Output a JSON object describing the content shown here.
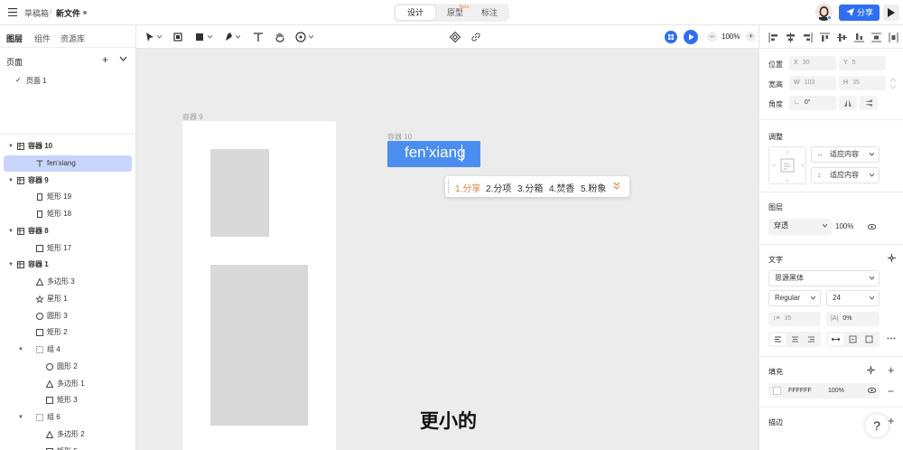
{
  "topbar": {
    "breadcrumb_parent": "草稿箱",
    "breadcrumb_sep": "/",
    "file_name": "新文件",
    "tabs": [
      "设计",
      "原型",
      "标注"
    ],
    "beta": "Beta",
    "share_label": "分享"
  },
  "left_panel": {
    "tabs": [
      "图层",
      "组件",
      "资源库"
    ],
    "pages_title": "页面",
    "pages_add": "+",
    "page_item": "页面 1",
    "page_check": "✓",
    "layers": [
      {
        "name": "容器 10",
        "icon": "frame-icon",
        "bold": true,
        "indent": 0,
        "arrow": true
      },
      {
        "name": "fen'xiang",
        "icon": "text-icon",
        "bold": false,
        "indent": 1,
        "arrow": false,
        "selected": true
      },
      {
        "name": "容器 9",
        "icon": "frame-icon",
        "bold": true,
        "indent": 0,
        "arrow": true
      },
      {
        "name": "矩形 19",
        "icon": "rect-icon",
        "bold": false,
        "indent": 1,
        "arrow": false
      },
      {
        "name": "矩形 18",
        "icon": "rect-icon",
        "bold": false,
        "indent": 1,
        "arrow": false
      },
      {
        "name": "容器 8",
        "icon": "frame-icon",
        "bold": true,
        "indent": 0,
        "arrow": true
      },
      {
        "name": "矩形 17",
        "icon": "square-icon",
        "bold": false,
        "indent": 1,
        "arrow": false
      },
      {
        "name": "容器 1",
        "icon": "frame-icon",
        "bold": true,
        "indent": 0,
        "arrow": true
      },
      {
        "name": "多边形 3",
        "icon": "triangle-icon",
        "bold": false,
        "indent": 1,
        "arrow": false
      },
      {
        "name": "星形 1",
        "icon": "star-icon",
        "bold": false,
        "indent": 1,
        "arrow": false
      },
      {
        "name": "圆形 3",
        "icon": "circle-icon",
        "bold": false,
        "indent": 1,
        "arrow": false
      },
      {
        "name": "矩形 2",
        "icon": "square-icon",
        "bold": false,
        "indent": 1,
        "arrow": false
      },
      {
        "name": "组 4",
        "icon": "group-icon",
        "bold": false,
        "indent": 1,
        "arrow": true
      },
      {
        "name": "圆形 2",
        "icon": "circle-icon",
        "bold": false,
        "indent": 2,
        "arrow": false
      },
      {
        "name": "多边形 1",
        "icon": "triangle-icon",
        "bold": false,
        "indent": 2,
        "arrow": false
      },
      {
        "name": "矩形 3",
        "icon": "square-icon",
        "bold": false,
        "indent": 2,
        "arrow": false
      },
      {
        "name": "组 6",
        "icon": "group-icon",
        "bold": false,
        "indent": 1,
        "arrow": true
      },
      {
        "name": "多边形 2",
        "icon": "triangle-icon",
        "bold": false,
        "indent": 2,
        "arrow": false
      },
      {
        "name": "矩形 5",
        "icon": "square-icon",
        "bold": false,
        "indent": 2,
        "arrow": false
      }
    ]
  },
  "toolbar": {
    "zoom_value": "100%",
    "zoom_minus": "−",
    "zoom_plus": "+"
  },
  "canvas": {
    "frame9_label": "容器 9",
    "frame10_label": "容器 10",
    "frame10_text": "fen'xiang",
    "ime_candidates": [
      "1.分享",
      "2.分项",
      "3.分箱",
      "4.焚香",
      "5.粉象"
    ],
    "subtitle": "更小的"
  },
  "right_panel": {
    "position_label": "位置",
    "x_key": "X",
    "x_value": "30",
    "y_key": "Y",
    "y_value": "5",
    "size_label": "宽高",
    "w_key": "W",
    "w_value": "103",
    "h_key": "H",
    "h_value": "35",
    "angle_label": "角度",
    "angle_value": "0°",
    "adjust_title": "调整",
    "adjust_h": "适应内容",
    "adjust_v": "适应内容",
    "layer_title": "图层",
    "blend_mode": "穿透",
    "opacity": "100%",
    "text_title": "文字",
    "font_family": "思源黑体",
    "font_weight": "Regular",
    "font_size": "24",
    "line_height": "35",
    "letter_spacing": "0%",
    "fill_title": "填充",
    "fill_hex": "FFFFFF",
    "fill_opacity": "100%",
    "stroke_title": "描边",
    "help": "?"
  },
  "colors": {
    "accent": "#2f6ef0",
    "selection": "#4a8ef0",
    "layer_selected": "#c8d6fb",
    "ime_highlight": "#e0803a"
  }
}
